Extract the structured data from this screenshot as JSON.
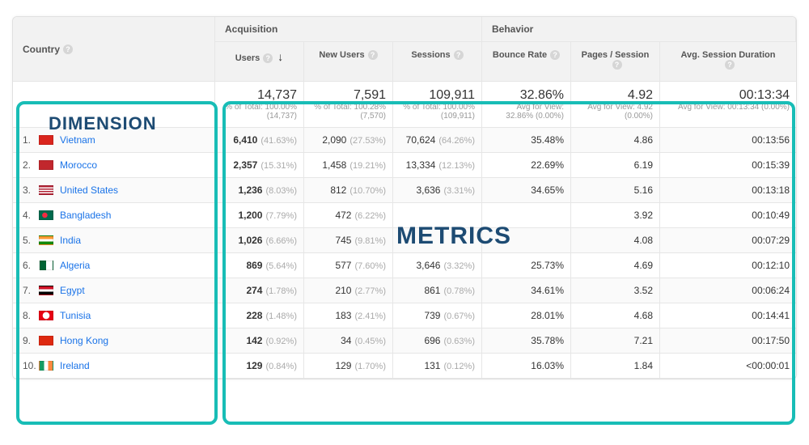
{
  "annotations": {
    "dimension_label": "DIMENSION",
    "metrics_label": "METRICS"
  },
  "header": {
    "dimension": "Country",
    "groups": {
      "acquisition": "Acquisition",
      "behavior": "Behavior"
    },
    "columns": {
      "users": "Users",
      "new_users": "New Users",
      "sessions": "Sessions",
      "bounce": "Bounce Rate",
      "pps": "Pages / Session",
      "asd": "Avg. Session Duration"
    },
    "sort_indicator": "↓"
  },
  "totals": {
    "users": {
      "value": "14,737",
      "sub": "% of Total: 100.00% (14,737)"
    },
    "new_users": {
      "value": "7,591",
      "sub": "% of Total: 100.28% (7,570)"
    },
    "sessions": {
      "value": "109,911",
      "sub": "% of Total: 100.00% (109,911)"
    },
    "bounce": {
      "value": "32.86%",
      "sub": "Avg for View: 32.86% (0.00%)"
    },
    "pps": {
      "value": "4.92",
      "sub": "Avg for View: 4.92 (0.00%)"
    },
    "asd": {
      "value": "00:13:34",
      "sub": "Avg for View: 00:13:34 (0.00%)"
    }
  },
  "rows": [
    {
      "rank": "1.",
      "flag": "flag-vn",
      "name": "Vietnam",
      "users": "6,410",
      "users_pct": "(41.63%)",
      "new": "2,090",
      "new_pct": "(27.53%)",
      "sess": "70,624",
      "sess_pct": "(64.26%)",
      "bounce": "35.48%",
      "pps": "4.86",
      "asd": "00:13:56"
    },
    {
      "rank": "2.",
      "flag": "flag-ma",
      "name": "Morocco",
      "users": "2,357",
      "users_pct": "(15.31%)",
      "new": "1,458",
      "new_pct": "(19.21%)",
      "sess": "13,334",
      "sess_pct": "(12.13%)",
      "bounce": "22.69%",
      "pps": "6.19",
      "asd": "00:15:39"
    },
    {
      "rank": "3.",
      "flag": "flag-us",
      "name": "United States",
      "users": "1,236",
      "users_pct": "(8.03%)",
      "new": "812",
      "new_pct": "(10.70%)",
      "sess": "3,636",
      "sess_pct": "(3.31%)",
      "bounce": "34.65%",
      "pps": "5.16",
      "asd": "00:13:18"
    },
    {
      "rank": "4.",
      "flag": "flag-bd",
      "name": "Bangladesh",
      "users": "1,200",
      "users_pct": "(7.79%)",
      "new": "472",
      "new_pct": "(6.22%)",
      "sess": "",
      "sess_pct": "",
      "bounce": "",
      "pps": "3.92",
      "asd": "00:10:49"
    },
    {
      "rank": "5.",
      "flag": "flag-in",
      "name": "India",
      "users": "1,026",
      "users_pct": "(6.66%)",
      "new": "745",
      "new_pct": "(9.81%)",
      "sess": "",
      "sess_pct": "",
      "bounce": "",
      "pps": "4.08",
      "asd": "00:07:29"
    },
    {
      "rank": "6.",
      "flag": "flag-dz",
      "name": "Algeria",
      "users": "869",
      "users_pct": "(5.64%)",
      "new": "577",
      "new_pct": "(7.60%)",
      "sess": "3,646",
      "sess_pct": "(3.32%)",
      "bounce": "25.73%",
      "pps": "4.69",
      "asd": "00:12:10"
    },
    {
      "rank": "7.",
      "flag": "flag-eg",
      "name": "Egypt",
      "users": "274",
      "users_pct": "(1.78%)",
      "new": "210",
      "new_pct": "(2.77%)",
      "sess": "861",
      "sess_pct": "(0.78%)",
      "bounce": "34.61%",
      "pps": "3.52",
      "asd": "00:06:24"
    },
    {
      "rank": "8.",
      "flag": "flag-tn",
      "name": "Tunisia",
      "users": "228",
      "users_pct": "(1.48%)",
      "new": "183",
      "new_pct": "(2.41%)",
      "sess": "739",
      "sess_pct": "(0.67%)",
      "bounce": "28.01%",
      "pps": "4.68",
      "asd": "00:14:41"
    },
    {
      "rank": "9.",
      "flag": "flag-hk",
      "name": "Hong Kong",
      "users": "142",
      "users_pct": "(0.92%)",
      "new": "34",
      "new_pct": "(0.45%)",
      "sess": "696",
      "sess_pct": "(0.63%)",
      "bounce": "35.78%",
      "pps": "7.21",
      "asd": "00:17:50"
    },
    {
      "rank": "10.",
      "flag": "flag-ie",
      "name": "Ireland",
      "users": "129",
      "users_pct": "(0.84%)",
      "new": "129",
      "new_pct": "(1.70%)",
      "sess": "131",
      "sess_pct": "(0.12%)",
      "bounce": "16.03%",
      "pps": "1.84",
      "asd": "<00:00:01"
    }
  ],
  "chart_data": {
    "type": "table",
    "dimension": "Country",
    "metrics": [
      "Users",
      "New Users",
      "Sessions",
      "Bounce Rate",
      "Pages / Session",
      "Avg. Session Duration"
    ],
    "rows": [
      [
        "Vietnam",
        6410,
        2090,
        70624,
        35.48,
        4.86,
        "00:13:56"
      ],
      [
        "Morocco",
        2357,
        1458,
        13334,
        22.69,
        6.19,
        "00:15:39"
      ],
      [
        "United States",
        1236,
        812,
        3636,
        34.65,
        5.16,
        "00:13:18"
      ],
      [
        "Bangladesh",
        1200,
        472,
        null,
        null,
        3.92,
        "00:10:49"
      ],
      [
        "India",
        1026,
        745,
        null,
        null,
        4.08,
        "00:07:29"
      ],
      [
        "Algeria",
        869,
        577,
        3646,
        25.73,
        4.69,
        "00:12:10"
      ],
      [
        "Egypt",
        274,
        210,
        861,
        34.61,
        3.52,
        "00:06:24"
      ],
      [
        "Tunisia",
        228,
        183,
        739,
        28.01,
        4.68,
        "00:14:41"
      ],
      [
        "Hong Kong",
        142,
        34,
        696,
        35.78,
        7.21,
        "00:17:50"
      ],
      [
        "Ireland",
        129,
        129,
        131,
        16.03,
        1.84,
        "<00:00:01"
      ]
    ],
    "totals": {
      "Users": 14737,
      "New Users": 7591,
      "Sessions": 109911,
      "Bounce Rate": 32.86,
      "Pages / Session": 4.92,
      "Avg. Session Duration": "00:13:34"
    }
  }
}
